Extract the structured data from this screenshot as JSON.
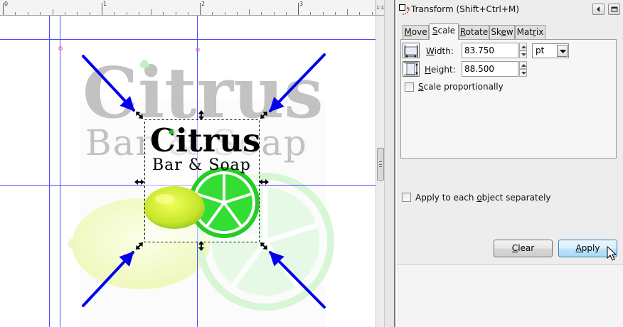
{
  "ruler": {
    "labels": [
      "0",
      "1",
      "2",
      "3"
    ],
    "zoom_label": "1:1"
  },
  "artwork": {
    "logo_title": "Citrus",
    "logo_subtitle": "Bar & Soap",
    "colors": {
      "selection_blue": "#0000ee",
      "lime_green": "#22cc22",
      "lemon_yellow": "#ddee33",
      "faded_text": "#c2c2c2"
    }
  },
  "dialog": {
    "title": "Transform (Shift+Ctrl+M)",
    "tabs": [
      {
        "label": "Move",
        "underline_index": 0
      },
      {
        "label": "Scale",
        "underline_index": 0
      },
      {
        "label": "Rotate",
        "underline_index": 0
      },
      {
        "label": "Skew",
        "underline_index": 2
      },
      {
        "label": "Matrix",
        "underline_index": 3
      }
    ],
    "active_tab": "Scale",
    "width": {
      "label": "Width:",
      "value": "83.750"
    },
    "height": {
      "label": "Height:",
      "value": "88.500"
    },
    "unit": "pt",
    "scale_proportionally": {
      "label": "Scale proportionally",
      "checked": false
    },
    "apply_each": {
      "label": "Apply to each object separately",
      "checked": false
    },
    "clear_label": "Clear",
    "apply_label": "Apply"
  }
}
